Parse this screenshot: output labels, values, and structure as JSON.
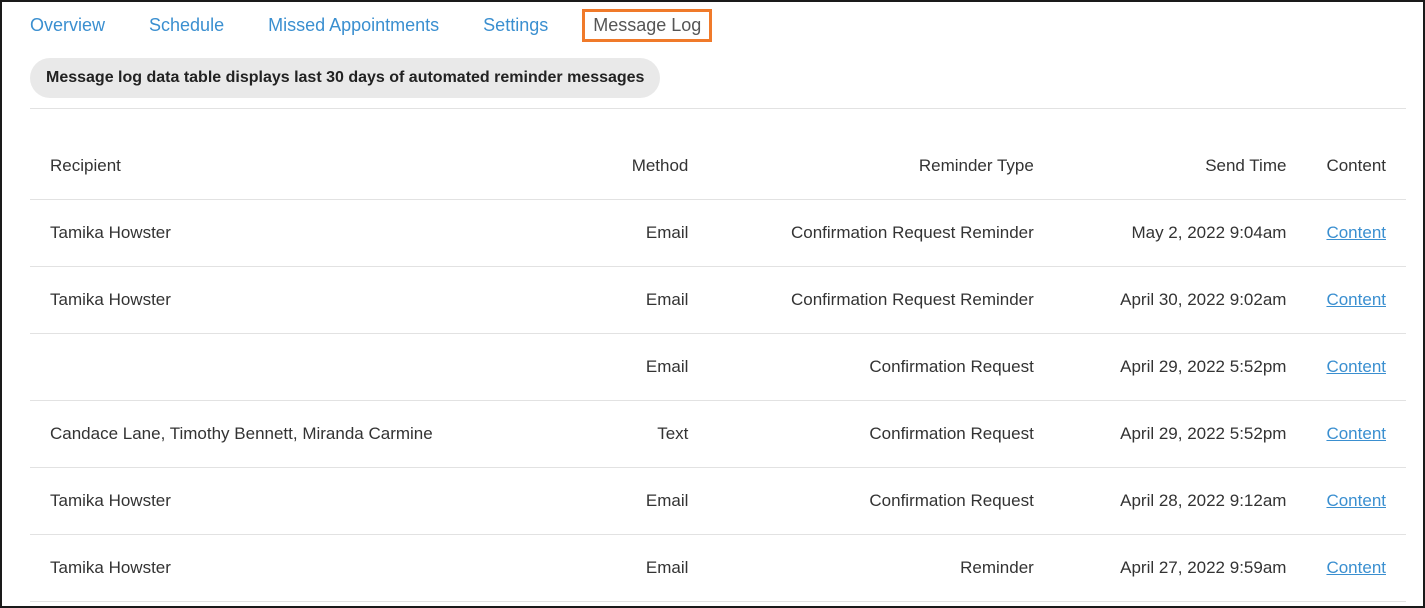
{
  "tabs": [
    {
      "label": "Overview",
      "active": false
    },
    {
      "label": "Schedule",
      "active": false
    },
    {
      "label": "Missed Appointments",
      "active": false
    },
    {
      "label": "Settings",
      "active": false
    },
    {
      "label": "Message Log",
      "active": true
    }
  ],
  "banner": {
    "text": "Message log data table displays last 30 days of automated reminder messages"
  },
  "table": {
    "headers": {
      "recipient": "Recipient",
      "method": "Method",
      "reminder_type": "Reminder Type",
      "send_time": "Send Time",
      "content": "Content"
    },
    "rows": [
      {
        "recipient": "Tamika Howster",
        "method": "Email",
        "reminder_type": "Confirmation Request Reminder",
        "send_time": "May 2, 2022 9:04am",
        "content": "Content"
      },
      {
        "recipient": "Tamika Howster",
        "method": "Email",
        "reminder_type": "Confirmation Request Reminder",
        "send_time": "April 30, 2022 9:02am",
        "content": "Content"
      },
      {
        "recipient": "",
        "method": "Email",
        "reminder_type": "Confirmation Request",
        "send_time": "April 29, 2022 5:52pm",
        "content": "Content"
      },
      {
        "recipient": "Candace Lane, Timothy Bennett, Miranda Carmine",
        "method": "Text",
        "reminder_type": "Confirmation Request",
        "send_time": "April 29, 2022 5:52pm",
        "content": "Content"
      },
      {
        "recipient": "Tamika Howster",
        "method": "Email",
        "reminder_type": "Confirmation Request",
        "send_time": "April 28, 2022 9:12am",
        "content": "Content"
      },
      {
        "recipient": "Tamika Howster",
        "method": "Email",
        "reminder_type": "Reminder",
        "send_time": "April 27, 2022 9:59am",
        "content": "Content"
      }
    ]
  },
  "colors": {
    "link": "#3a8fd0",
    "active_tab_border": "#f07a2a",
    "banner_bg": "#e9e9e9"
  }
}
